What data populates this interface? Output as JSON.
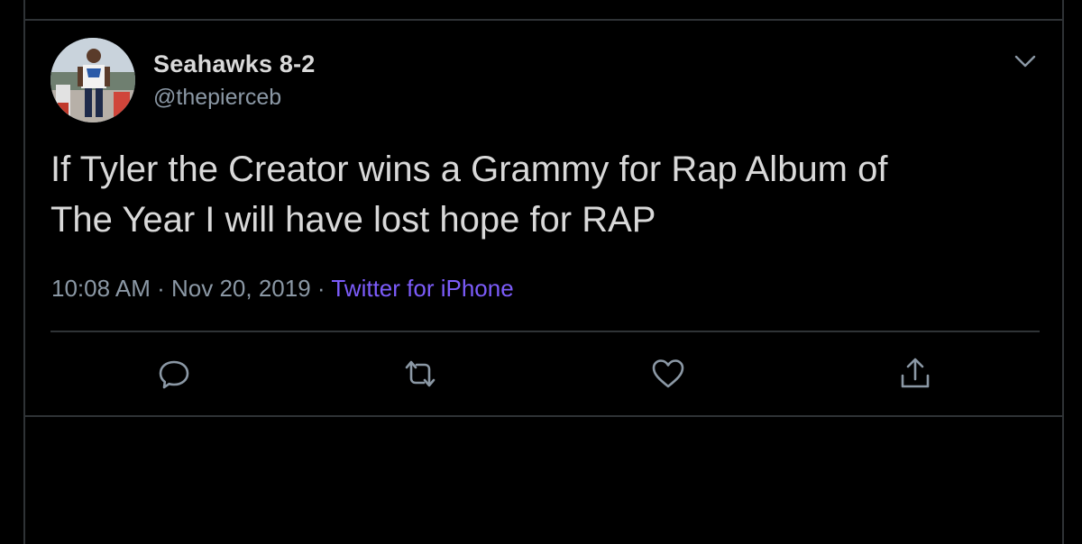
{
  "tweet": {
    "display_name": "Seahawks 8-2",
    "handle": "@thepierceb",
    "text": "If Tyler the Creator wins a Grammy for Rap Album of\nThe Year I will have lost hope for RAP",
    "time": "10:08 AM",
    "date": "Nov 20, 2019",
    "separator": "·",
    "source": "Twitter for iPhone"
  },
  "actions": {
    "reply_icon": "reply-icon",
    "retweet_icon": "retweet-icon",
    "like_icon": "heart-icon",
    "share_icon": "share-icon"
  },
  "colors": {
    "background": "#000000",
    "text": "#d9d9d9",
    "muted": "#8b98a5",
    "source_link": "#7c5cfa",
    "border": "#2f3336"
  }
}
